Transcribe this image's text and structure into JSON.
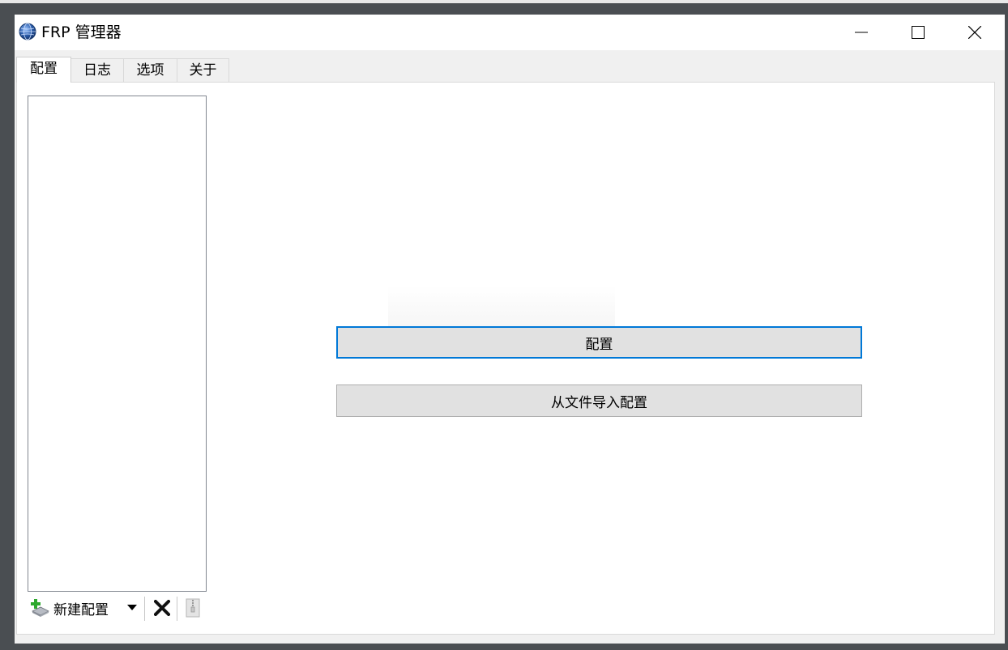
{
  "window": {
    "title": "FRP 管理器",
    "icon": "globe-icon",
    "controls": [
      "minimize-icon",
      "maximize-icon",
      "close-icon"
    ]
  },
  "tabs": [
    {
      "label": "配置",
      "active": true
    },
    {
      "label": "日志",
      "active": false
    },
    {
      "label": "选项",
      "active": false
    },
    {
      "label": "关于",
      "active": false
    }
  ],
  "sidebar": {
    "config_list": [],
    "toolbar": {
      "new_config_label": "新建配置",
      "new_icon": "add-config-icon",
      "dropdown_icon": "dropdown-arrow-icon",
      "delete_icon": "delete-icon",
      "archive_icon": "zip-archive-icon"
    }
  },
  "main": {
    "add_button_label": "配置",
    "import_button_label": "从文件导入配置"
  },
  "colors": {
    "focus_border": "#0078d7",
    "button_bg": "#e1e1e1",
    "window_bg": "#f0f0f0"
  }
}
